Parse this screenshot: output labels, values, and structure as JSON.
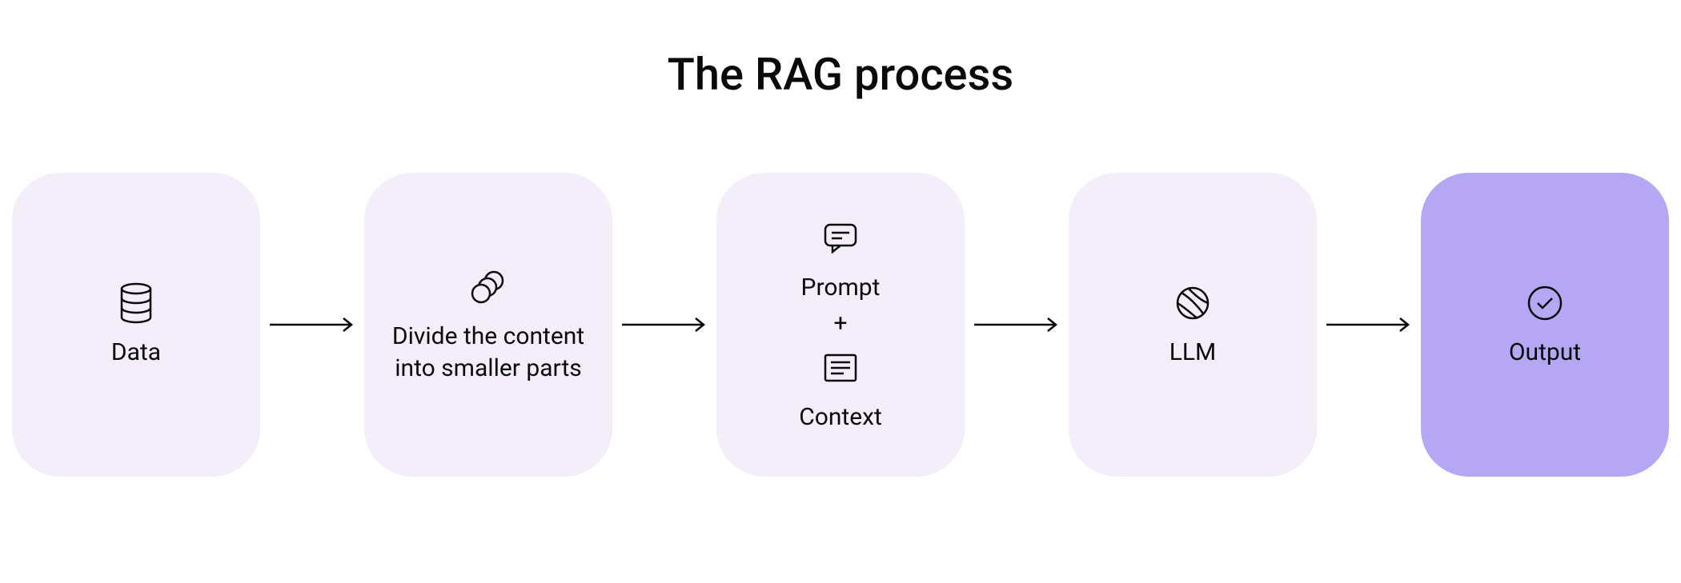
{
  "title": "The RAG process",
  "steps": {
    "data": {
      "label": "Data"
    },
    "divide": {
      "label": "Divide the content into smaller parts"
    },
    "prompt": {
      "top_label": "Prompt",
      "plus": "+",
      "bottom_label": "Context"
    },
    "llm": {
      "label": "LLM"
    },
    "output": {
      "label": "Output"
    }
  }
}
